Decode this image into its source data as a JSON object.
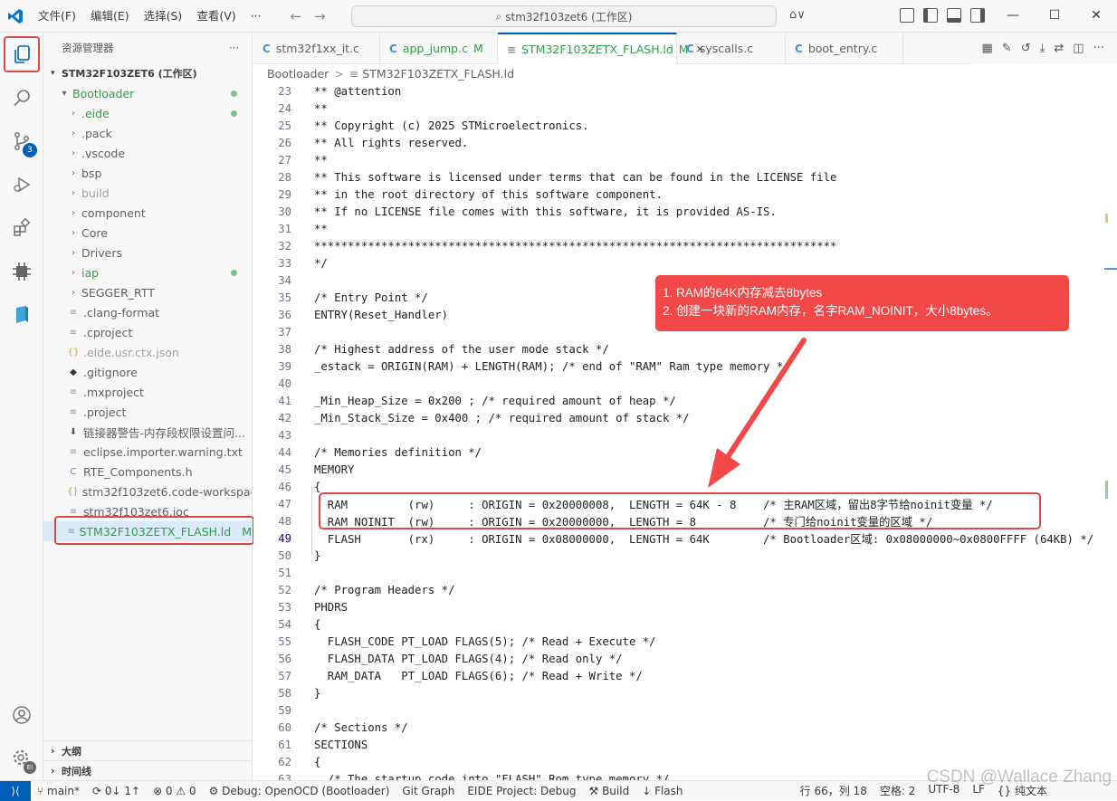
{
  "titlebar": {
    "menus": [
      "文件(F)",
      "编辑(E)",
      "选择(S)",
      "查看(V)",
      "···"
    ],
    "search": "stm32f103zet6 (工作区)",
    "copilot": "⌂∨"
  },
  "activity": {
    "scm_badge": "3",
    "accounts_badge": "EI"
  },
  "sidebar": {
    "title": "资源管理器",
    "more": "···",
    "project": "STM32F103ZET6 (工作区)",
    "tree": [
      {
        "label": "Bootloader",
        "depth": 1,
        "type": "folder-open",
        "color": "#2c9f45",
        "dot": true
      },
      {
        "label": ".eide",
        "depth": 2,
        "type": "folder",
        "color": "#2c9f45",
        "dot": true
      },
      {
        "label": ".pack",
        "depth": 2,
        "type": "folder",
        "color": "#616161"
      },
      {
        "label": ".vscode",
        "depth": 2,
        "type": "folder",
        "color": "#616161"
      },
      {
        "label": "bsp",
        "depth": 2,
        "type": "folder",
        "color": "#616161"
      },
      {
        "label": "build",
        "depth": 2,
        "type": "folder",
        "color": "#a0a0a0"
      },
      {
        "label": "component",
        "depth": 2,
        "type": "folder",
        "color": "#616161"
      },
      {
        "label": "Core",
        "depth": 2,
        "type": "folder",
        "color": "#616161"
      },
      {
        "label": "Drivers",
        "depth": 2,
        "type": "folder",
        "color": "#616161"
      },
      {
        "label": "iap",
        "depth": 2,
        "type": "folder",
        "color": "#2c9f45",
        "dot": true
      },
      {
        "label": "SEGGER_RTT",
        "depth": 2,
        "type": "folder",
        "color": "#616161"
      },
      {
        "label": ".clang-format",
        "depth": 2,
        "type": "file",
        "icon": "≡",
        "color": "#616161"
      },
      {
        "label": ".cproject",
        "depth": 2,
        "type": "file",
        "icon": "≡",
        "color": "#616161"
      },
      {
        "label": ".eide.usr.ctx.json",
        "depth": 2,
        "type": "file",
        "icon": "{}",
        "color": "#a0a0a0"
      },
      {
        "label": ".gitignore",
        "depth": 2,
        "type": "file",
        "icon": "◆",
        "color": "#616161"
      },
      {
        "label": ".mxproject",
        "depth": 2,
        "type": "file",
        "icon": "≡",
        "color": "#616161"
      },
      {
        "label": ".project",
        "depth": 2,
        "type": "file",
        "icon": "≡",
        "color": "#616161"
      },
      {
        "label": "链接器警告-内存段权限设置问...",
        "depth": 2,
        "type": "file",
        "icon": "⬇",
        "color": "#616161"
      },
      {
        "label": "eclipse.importer.warning.txt",
        "depth": 2,
        "type": "file",
        "icon": "≡",
        "color": "#616161"
      },
      {
        "label": "RTE_Components.h",
        "depth": 2,
        "type": "file",
        "icon": "C",
        "color": "#616161"
      },
      {
        "label": "stm32f103zet6.code-workspace",
        "depth": 2,
        "type": "file",
        "icon": "{}",
        "color": "#616161"
      },
      {
        "label": "stm32f103zet6.ioc",
        "depth": 2,
        "type": "file",
        "icon": "≡",
        "color": "#616161"
      },
      {
        "label": "STM32F103ZETX_FLASH.ld",
        "depth": 2,
        "type": "file",
        "icon": "≡",
        "color": "#2c9f45",
        "selected": true,
        "mod": "M"
      }
    ],
    "outline": "大纲",
    "timeline": "时间线"
  },
  "tabs": [
    {
      "label": "stm32f1xx_it.c",
      "icon": "C",
      "mod": "",
      "active": false,
      "color": "#616161"
    },
    {
      "label": "app_jump.c",
      "icon": "C",
      "mod": "M",
      "active": false,
      "color": "#2c9f45"
    },
    {
      "label": "STM32F103ZETX_FLASH.ld",
      "icon": "≡",
      "mod": "M",
      "active": true,
      "color": "#2c9f45"
    },
    {
      "label": "syscalls.c",
      "icon": "C",
      "mod": "",
      "active": false,
      "color": "#616161"
    },
    {
      "label": "boot_entry.c",
      "icon": "C",
      "mod": "",
      "active": false,
      "color": "#616161"
    }
  ],
  "breadcrumb": [
    "Bootloader",
    ">",
    "≡",
    "STM32F103ZETX_FLASH.ld"
  ],
  "code": [
    {
      "n": "23",
      "t": "** @attention"
    },
    {
      "n": "24",
      "t": "**"
    },
    {
      "n": "25",
      "t": "** Copyright (c) 2025 STMicroelectronics."
    },
    {
      "n": "26",
      "t": "** All rights reserved."
    },
    {
      "n": "27",
      "t": "**"
    },
    {
      "n": "28",
      "t": "** This software is licensed under terms that can be found in the LICENSE file"
    },
    {
      "n": "29",
      "t": "** in the root directory of this software component."
    },
    {
      "n": "30",
      "t": "** If no LICENSE file comes with this software, it is provided AS-IS."
    },
    {
      "n": "31",
      "t": "**"
    },
    {
      "n": "32",
      "t": "******************************************************************************"
    },
    {
      "n": "33",
      "t": "*/"
    },
    {
      "n": "34",
      "t": ""
    },
    {
      "n": "35",
      "t": "/* Entry Point */"
    },
    {
      "n": "36",
      "t": "ENTRY(Reset_Handler)"
    },
    {
      "n": "37",
      "t": ""
    },
    {
      "n": "38",
      "t": "/* Highest address of the user mode stack */"
    },
    {
      "n": "39",
      "t": "_estack = ORIGIN(RAM) + LENGTH(RAM); /* end of \"RAM\" Ram type memory */"
    },
    {
      "n": "40",
      "t": ""
    },
    {
      "n": "41",
      "t": "_Min_Heap_Size = 0x200 ; /* required amount of heap */"
    },
    {
      "n": "42",
      "t": "_Min_Stack_Size = 0x400 ; /* required amount of stack */"
    },
    {
      "n": "43",
      "t": ""
    },
    {
      "n": "44",
      "t": "/* Memories definition */"
    },
    {
      "n": "45",
      "t": "MEMORY"
    },
    {
      "n": "46",
      "t": "{"
    },
    {
      "n": "47",
      "t": "  RAM         (rw)     : ORIGIN = 0x20000008,  LENGTH = 64K - 8    /* 主RAM区域，留出8字节给noinit变量 */"
    },
    {
      "n": "48",
      "t": "  RAM_NOINIT  (rw)     : ORIGIN = 0x20000000,  LENGTH = 8          /* 专门给noinit变量的区域 */"
    },
    {
      "n": "49",
      "t": "  FLASH       (rx)     : ORIGIN = 0x08000000,  LENGTH = 64K        /* Bootloader区域: 0x08000000~0x0800FFFF (64KB) */"
    },
    {
      "n": "50",
      "t": "}"
    },
    {
      "n": "51",
      "t": ""
    },
    {
      "n": "52",
      "t": "/* Program Headers */"
    },
    {
      "n": "53",
      "t": "PHDRS"
    },
    {
      "n": "54",
      "t": "{"
    },
    {
      "n": "55",
      "t": "  FLASH_CODE PT_LOAD FLAGS(5); /* Read + Execute */"
    },
    {
      "n": "56",
      "t": "  FLASH_DATA PT_LOAD FLAGS(4); /* Read only */"
    },
    {
      "n": "57",
      "t": "  RAM_DATA   PT_LOAD FLAGS(6); /* Read + Write */"
    },
    {
      "n": "58",
      "t": "}"
    },
    {
      "n": "59",
      "t": ""
    },
    {
      "n": "60",
      "t": "/* Sections */"
    },
    {
      "n": "61",
      "t": "SECTIONS"
    },
    {
      "n": "62",
      "t": "{"
    },
    {
      "n": "63",
      "t": "  /* The startup code into \"FLASH\" Rom type memory */"
    }
  ],
  "callout": {
    "line1": "1. RAM的64K内存减去8bytes",
    "line2": "2. 创建一块新的RAM内存，名字RAM_NOINIT，大小8bytes。"
  },
  "status": {
    "remote": "⟩⟨",
    "branch": "main*",
    "sync": "⟳ 0↓ 1↑",
    "problems": "⊗ 0 ⚠ 0",
    "debug": "Debug: OpenOCD (Bootloader)",
    "git_graph": "Git Graph",
    "eide": "EIDE Project: Debug",
    "build": "Build",
    "flash": "Flash",
    "position": "行 66，列 18",
    "spaces": "空格: 2",
    "encoding": "UTF-8",
    "eol": "LF",
    "lang": "{} 纯文本"
  },
  "watermark": "CSDN @Wallace Zhang",
  "colors": {
    "accent": "#005fb8",
    "annotation_red": "#e04848",
    "modified_green": "#2c9f45"
  }
}
